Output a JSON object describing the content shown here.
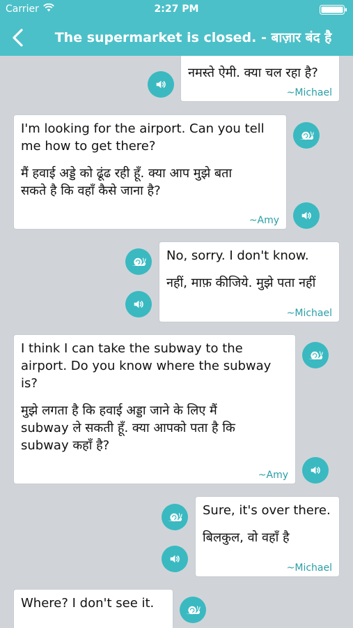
{
  "status": {
    "carrier": "Carrier",
    "time": "2:27 PM"
  },
  "nav": {
    "title": "The supermarket is closed. - बाज़ार बंद है"
  },
  "messages": [
    {
      "english": "",
      "hindi": "नमस्ते ऐमी. क्या चल रहा है?",
      "author": "~Michael"
    },
    {
      "english": "I'm looking for the airport. Can you tell\nme how to get there?",
      "hindi": "मैं हवाई अड्डे को ढूंढ रही हूँ. क्या आप मुझे बता\nसकते है कि वहाँ कैसे जाना है?",
      "author": "~Amy"
    },
    {
      "english": "No, sorry. I don't know.",
      "hindi": "नहीं, माफ़ कीजिये. मुझे पता नहीं",
      "author": "~Michael"
    },
    {
      "english": "I think I can take the subway to the\nairport. Do you know where the subway\nis?",
      "hindi": "मुझे लगता है कि हवाई अड्डा जाने के लिए मैं\nsubway ले सकती हूँ. क्या आपको पता है कि\nsubway कहाँ है?",
      "author": "~Amy"
    },
    {
      "english": "Sure, it's over there.",
      "hindi": "बिलकुल, वो वहाँ है",
      "author": "~Michael"
    },
    {
      "english": "Where? I don't see it.",
      "hindi": "",
      "author": ""
    }
  ],
  "icons": {
    "back": "chevron-left-icon",
    "slow": "snail-icon",
    "play": "speaker-icon",
    "wifi": "wifi-icon",
    "battery": "battery-icon"
  },
  "colors": {
    "accent": "#4cc0c8",
    "button": "#3ab9c1",
    "background": "#d0d4d8",
    "author": "#2a9ea6"
  }
}
